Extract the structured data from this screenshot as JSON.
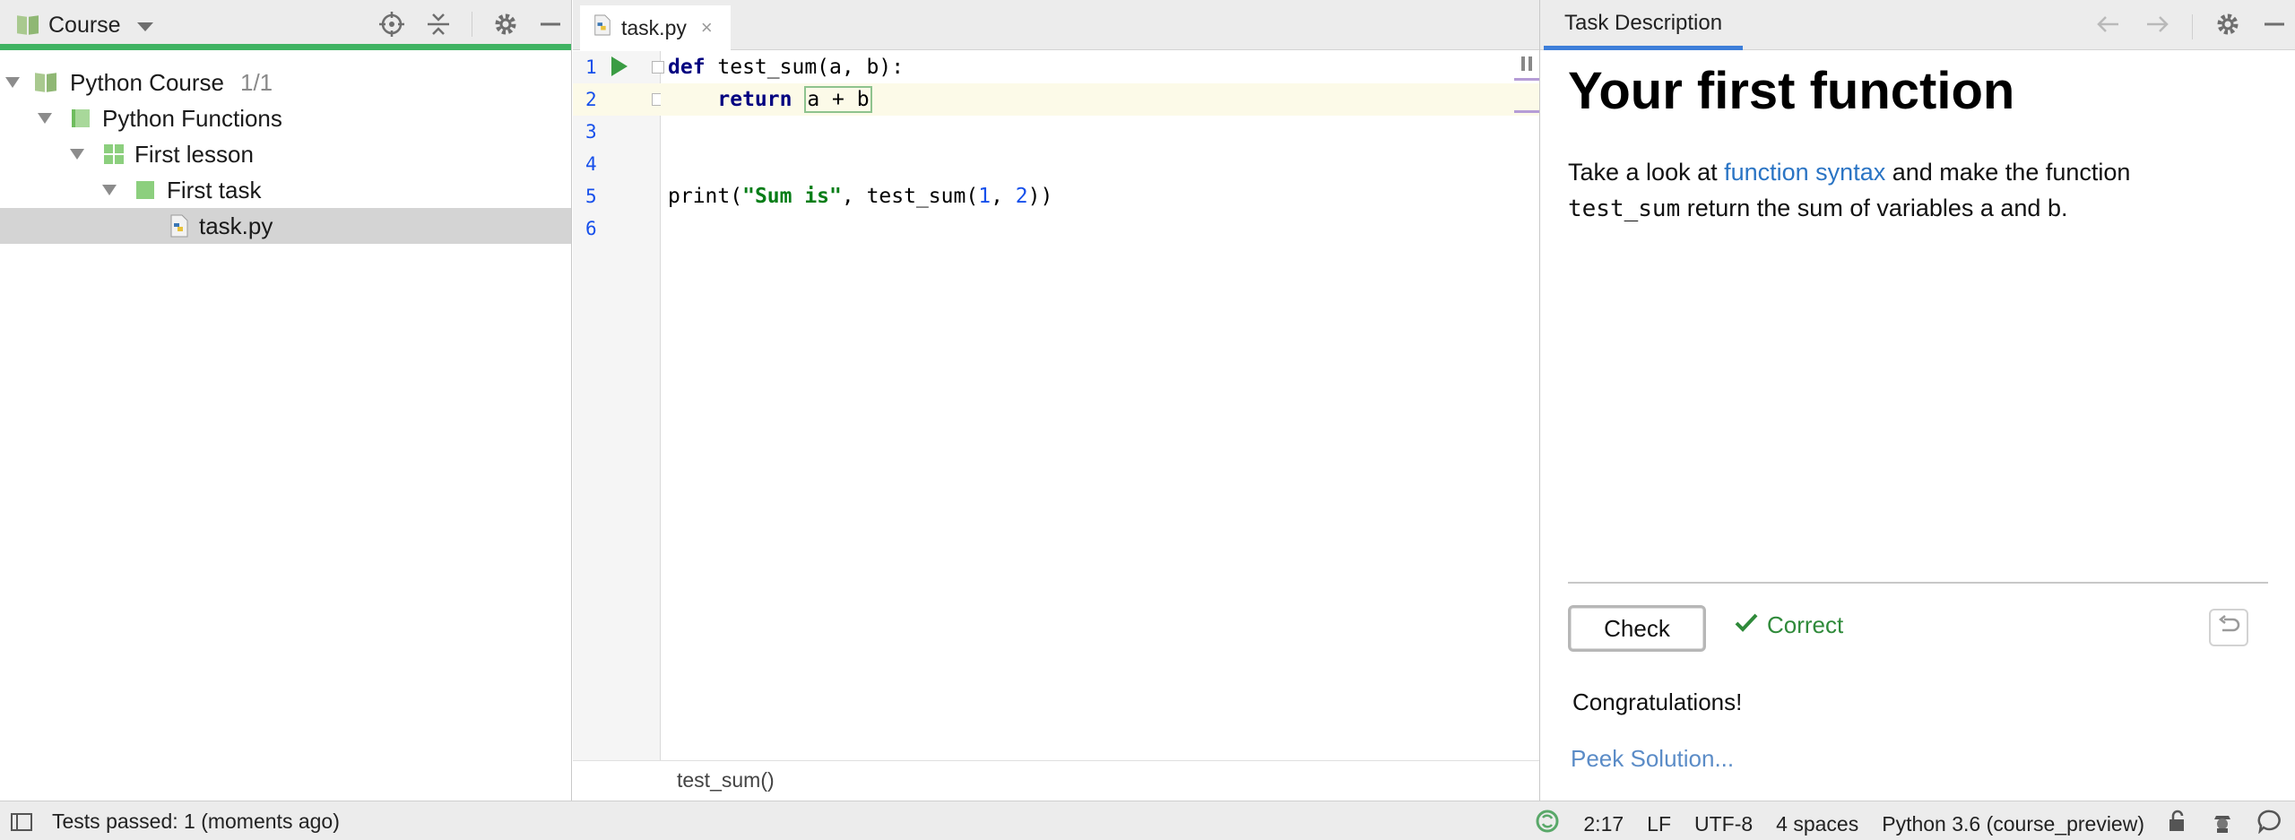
{
  "project": {
    "title": "Course",
    "tree": [
      {
        "label": "Python Course",
        "extra": "1/1"
      },
      {
        "label": "Python Functions"
      },
      {
        "label": "First lesson"
      },
      {
        "label": "First task"
      },
      {
        "label": "task.py"
      }
    ]
  },
  "editor": {
    "tab_label": "task.py",
    "tab_close": "×",
    "line_numbers": [
      "1",
      "2",
      "3",
      "4",
      "5",
      "6"
    ],
    "code": {
      "l1_kw": "def",
      "l1_rest": " test_sum(a, b):",
      "l2_indent": "    ",
      "l2_kw": "return",
      "l2_sp": " ",
      "l2_ph": "a + b",
      "l5_a": "print(",
      "l5_str": "\"Sum is\"",
      "l5_b": ", test_sum(",
      "l5_n1": "1",
      "l5_c": ", ",
      "l5_n2": "2",
      "l5_d": "))"
    },
    "breadcrumb": "test_sum()"
  },
  "task": {
    "tab_label": "Task Description",
    "title": "Your first function",
    "text_a": "Take a look at ",
    "text_link": "function syntax",
    "text_b": " and make the function",
    "text_code": "test_sum",
    "text_c": " return the sum of variables a and b.",
    "check_label": "Check",
    "status_label": "Correct",
    "congrats": "Congratulations!",
    "peek_label": "Peek Solution..."
  },
  "status_bar": {
    "message": "Tests passed: 1 (moments ago)",
    "position": "2:17",
    "line_sep": "LF",
    "encoding": "UTF-8",
    "indent": "4 spaces",
    "interpreter": "Python 3.6 (course_preview)"
  },
  "colors": {
    "accent_green": "#3fb362",
    "link_blue": "#2a74c4",
    "success_green": "#2f8a3a",
    "tab_underline": "#3d7ed9"
  }
}
